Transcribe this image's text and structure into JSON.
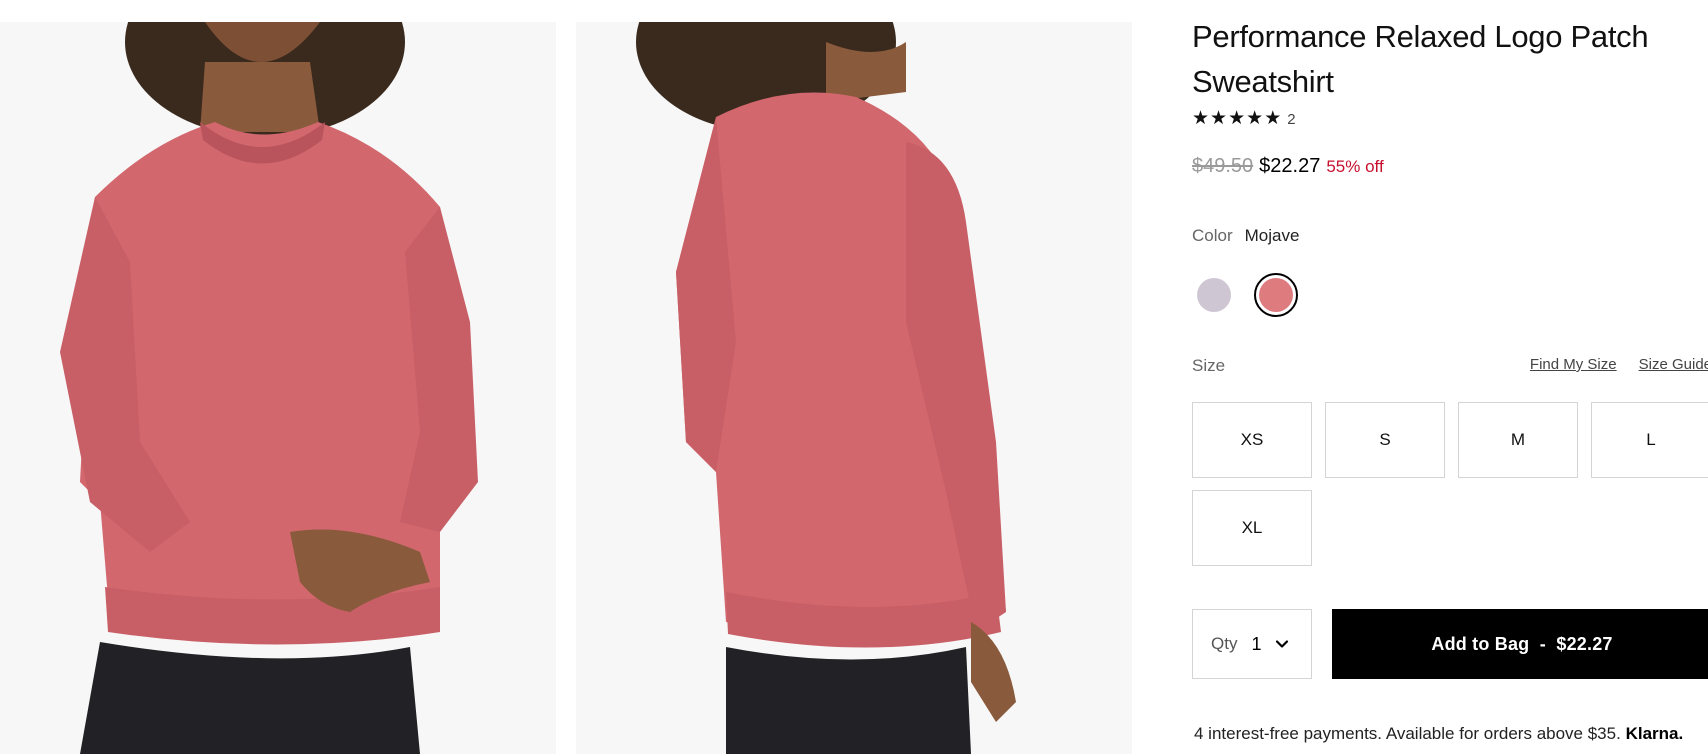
{
  "product": {
    "title": "Performance Relaxed Logo Patch Sweatshirt",
    "rating": {
      "stars": 5,
      "star_glyph": "★",
      "count": "2"
    },
    "price": {
      "original": "$49.50",
      "sale": "$22.27",
      "discount": "55% off"
    },
    "color": {
      "label": "Color",
      "selected": "Mojave"
    },
    "swatches": [
      {
        "name": "swatch-lavender",
        "color": "#cfc6d3",
        "selected": false
      },
      {
        "name": "swatch-mojave",
        "color": "#dd7b7f",
        "selected": true
      }
    ],
    "size": {
      "label": "Size",
      "links": [
        "Find My Size",
        "Size Guide"
      ],
      "options": [
        "XS",
        "S",
        "M",
        "L",
        "XL"
      ]
    },
    "qty": {
      "label": "Qty",
      "value": "1"
    },
    "add_to_bag": "Add to Bag  -  $22.27",
    "klarna": {
      "text": "4 interest-free payments. Available for orders above $35.",
      "brand": "Klarna."
    }
  },
  "colors": {
    "sweater": "#d2676e",
    "sweater_shadow": "#b9545c",
    "sweater_light": "#dc7a80",
    "skin": "#8a5a3c",
    "hair": "#3a2a1e",
    "pants": "#222226",
    "photo_bg": "#f7f7f7",
    "discount": "#c8102e"
  }
}
